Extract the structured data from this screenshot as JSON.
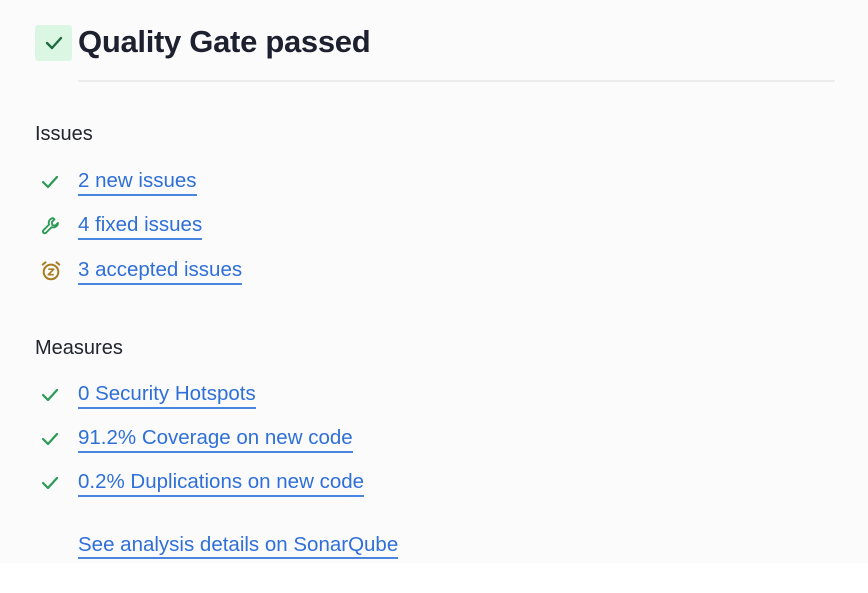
{
  "header": {
    "title": "Quality Gate passed",
    "status_icon": "check-icon"
  },
  "issues": {
    "title": "Issues",
    "items": [
      {
        "label": "2 new issues",
        "icon": "check-icon",
        "color": "#2b9a54"
      },
      {
        "label": "4 fixed issues",
        "icon": "wrench-icon",
        "color": "#2b9a54"
      },
      {
        "label": "3 accepted issues",
        "icon": "snooze-clock-icon",
        "color": "#a97c22"
      }
    ]
  },
  "measures": {
    "title": "Measures",
    "items": [
      {
        "label": "0 Security Hotspots",
        "icon": "check-icon"
      },
      {
        "label": "91.2% Coverage on new code",
        "icon": "check-icon"
      },
      {
        "label": "0.2% Duplications on new code",
        "icon": "check-icon"
      }
    ]
  },
  "footer": {
    "details_link": "See analysis details on SonarQube"
  },
  "colors": {
    "link": "#2f6fd8",
    "success": "#2b9a54",
    "accepted": "#a97c22",
    "badge_bg": "#dbf7e4"
  }
}
